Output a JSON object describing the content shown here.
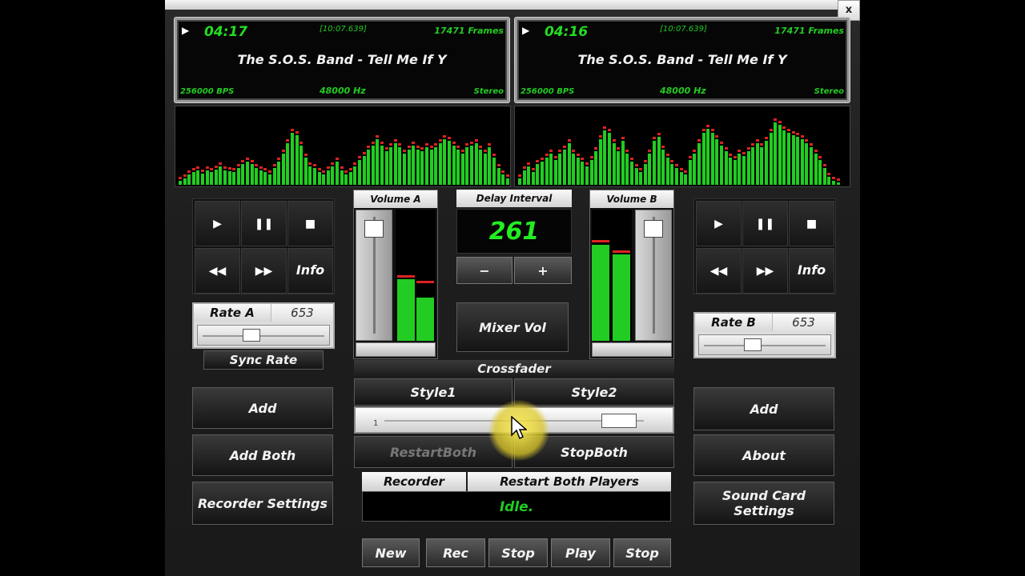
{
  "window": {
    "close_label": "x"
  },
  "deck_a": {
    "time": "04:17",
    "position": "[10:07.639]",
    "frames": "17471 Frames",
    "song": "The S.O.S. Band - Tell Me If Y",
    "bps": "256000 BPS",
    "hz": "48000 Hz",
    "channels": "Stereo",
    "rate_label": "Rate A",
    "rate_value": "653",
    "info_label": "Info",
    "add_label": "Add",
    "volume_label": "Volume A"
  },
  "deck_b": {
    "time": "04:16",
    "position": "[10:07.639]",
    "frames": "17471 Frames",
    "song": "The S.O.S. Band - Tell Me If Y",
    "bps": "256000 BPS",
    "hz": "48000 Hz",
    "channels": "Stereo",
    "rate_label": "Rate B",
    "rate_value": "653",
    "info_label": "Info",
    "add_label": "Add",
    "volume_label": "Volume B"
  },
  "controls": {
    "sync_rate": "Sync Rate",
    "add_both": "Add Both",
    "recorder_settings": "Recorder Settings",
    "about": "About",
    "sound_card_settings": "Sound Card Settings",
    "delay_title": "Delay Interval",
    "delay_value": "261",
    "minus": "−",
    "plus": "+",
    "mixer_vol": "Mixer Vol",
    "crossfader_title": "Crossfader",
    "style1": "Style1",
    "style2": "Style2",
    "xf_min": "1",
    "restart_both": "RestartBoth",
    "stop_both": "StopBoth"
  },
  "recorder": {
    "tab_recorder": "Recorder",
    "tab_restart": "Restart Both Players",
    "status": "Idle.",
    "buttons": [
      "New",
      "Rec",
      "Stop",
      "Play",
      "Stop"
    ]
  },
  "levels": {
    "volume_a_fader": 0.93,
    "volume_b_fader": 0.93,
    "meter_a": [
      0.47,
      0.33
    ],
    "meter_a_peak": [
      0.48,
      0.44
    ],
    "meter_b": [
      0.73,
      0.66
    ],
    "meter_b_peak": [
      0.75,
      0.67
    ],
    "rate_a": 0.38,
    "rate_b": 0.38,
    "crossfader": 0.92
  },
  "spectrum_a": [
    4,
    6,
    10,
    12,
    14,
    11,
    14,
    12,
    15,
    18,
    14,
    13,
    12,
    16,
    20,
    22,
    20,
    16,
    14,
    12,
    10,
    16,
    22,
    30,
    40,
    50,
    48,
    38,
    26,
    18,
    16,
    12,
    10,
    14,
    18,
    22,
    14,
    10,
    12,
    18,
    24,
    28,
    34,
    38,
    44,
    38,
    32,
    36,
    40,
    36,
    30,
    34,
    38,
    34,
    32,
    36,
    34,
    36,
    40,
    44,
    42,
    38,
    34,
    30,
    36,
    38,
    40,
    34,
    30,
    36,
    26,
    16,
    10,
    6
  ],
  "spectrum_b": [
    6,
    14,
    18,
    12,
    20,
    22,
    26,
    30,
    24,
    30,
    34,
    40,
    30,
    26,
    22,
    18,
    24,
    32,
    44,
    52,
    50,
    40,
    32,
    42,
    30,
    22,
    16,
    12,
    20,
    30,
    42,
    46,
    34,
    26,
    20,
    16,
    12,
    10,
    24,
    30,
    40,
    50,
    54,
    50,
    44,
    38,
    32,
    26,
    24,
    30,
    28,
    32,
    36,
    40,
    36,
    42,
    50,
    60,
    58,
    52,
    50,
    48,
    46,
    44,
    40,
    36,
    30,
    24,
    16,
    8,
    4,
    2
  ],
  "colors": {
    "lcd_green": "#22dd22",
    "peak_red": "#dd2222",
    "cursor_yellow": "#e8d83a"
  }
}
